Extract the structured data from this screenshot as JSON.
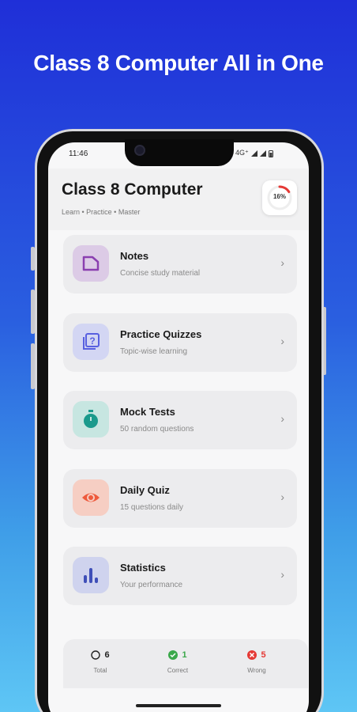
{
  "banner": {
    "title": "Class 8 Computer All in One"
  },
  "status_bar": {
    "time": "11:46",
    "network": "4G⁺"
  },
  "header": {
    "title": "Class 8 Computer",
    "subtitle": "Learn • Practice • Master",
    "progress_percent": 16,
    "progress_label": "16%"
  },
  "menu": [
    {
      "label": "Notes",
      "subtitle": "Concise study material",
      "icon": "document-icon",
      "color": "#8a3fb0",
      "bg": "#dccbe6"
    },
    {
      "label": "Practice Quizzes",
      "subtitle": "Topic-wise learning",
      "icon": "quiz-icon",
      "color": "#5860e0",
      "bg": "#d3d6f3"
    },
    {
      "label": "Mock Tests",
      "subtitle": "50 random questions",
      "icon": "stopwatch-icon",
      "color": "#1a9a8c",
      "bg": "#c7e6e1"
    },
    {
      "label": "Daily Quiz",
      "subtitle": "15 questions daily",
      "icon": "eye-icon",
      "color": "#ee5a3c",
      "bg": "#f6cec3"
    },
    {
      "label": "Statistics",
      "subtitle": "Your performance",
      "icon": "bar-chart-icon",
      "color": "#3f4fb8",
      "bg": "#cfd3ee"
    }
  ],
  "stats": {
    "total": {
      "value": "6",
      "label": "Total"
    },
    "correct": {
      "value": "1",
      "label": "Correct",
      "color": "#3aa84a"
    },
    "wrong": {
      "value": "5",
      "label": "Wrong",
      "color": "#e53935"
    }
  }
}
